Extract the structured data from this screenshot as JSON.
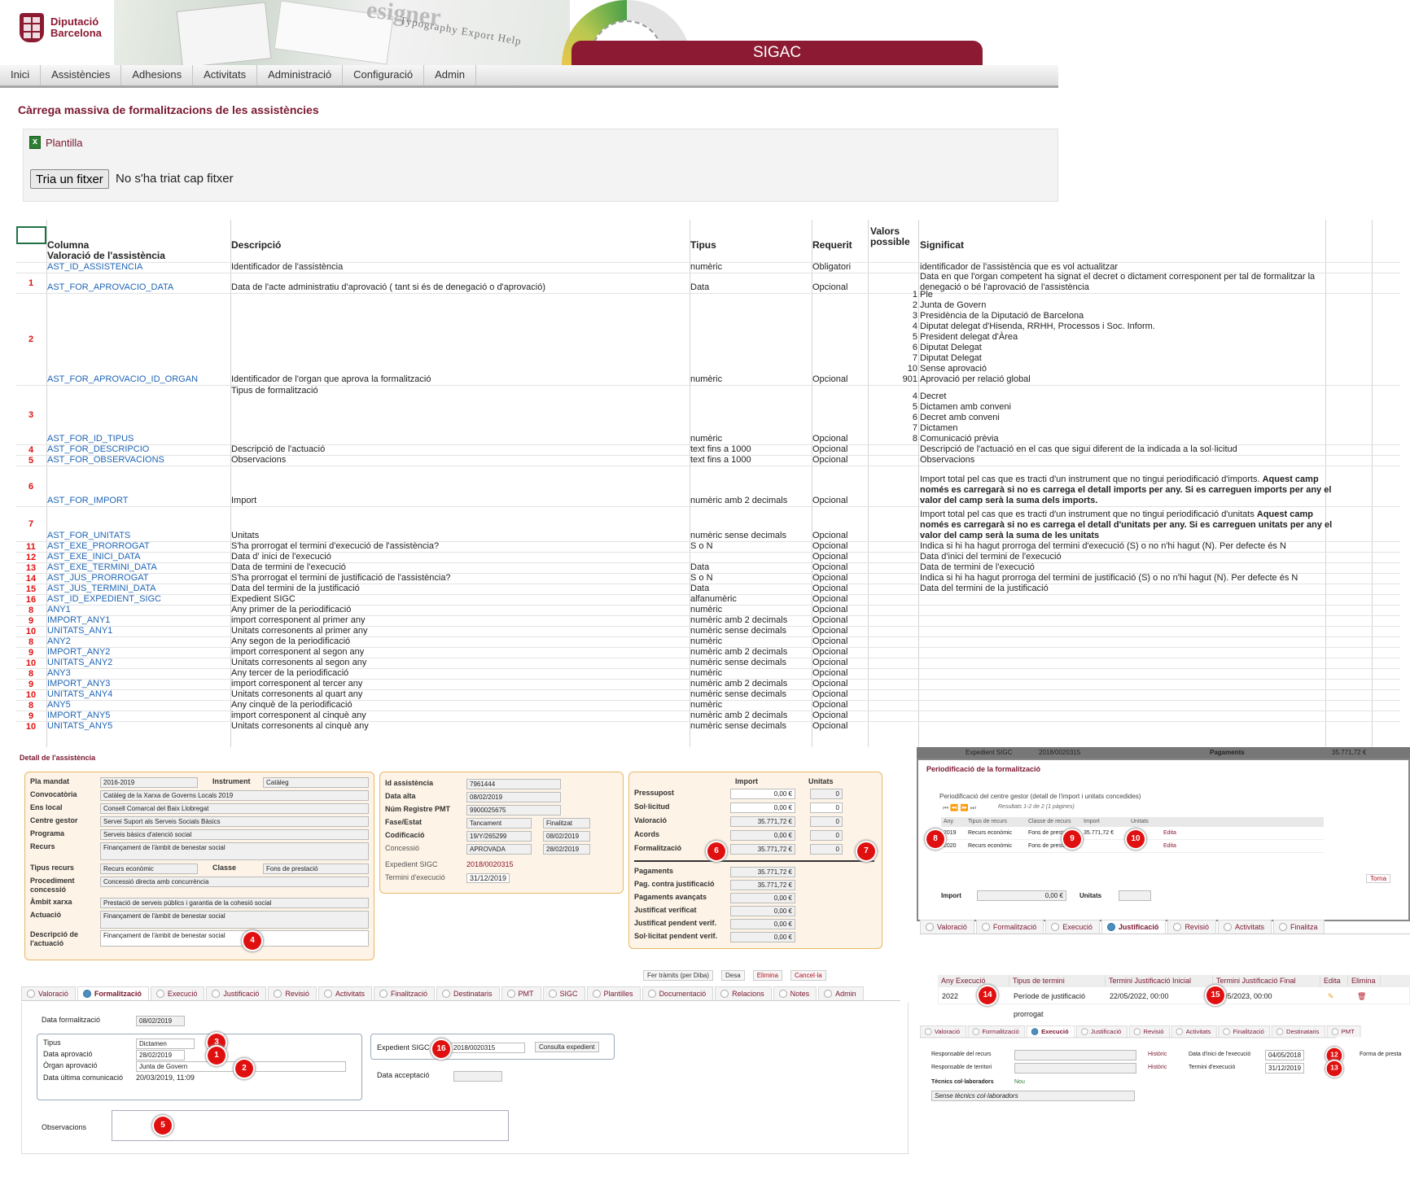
{
  "header": {
    "logo_line1": "Diputació",
    "logo_line2": "Barcelona",
    "banner_text1": "esigner",
    "banner_text2": "Typography  Export  Help",
    "app_name": "SIGAC"
  },
  "nav": [
    "Inici",
    "Assistències",
    "Adhesions",
    "Activitats",
    "Administració",
    "Configuració",
    "Admin"
  ],
  "page": {
    "title": "Càrrega massiva de formalitzacions de les assistències",
    "template_link": "Plantilla",
    "file_button": "Tria un fitxer",
    "file_status": "No s'ha triat cap fitxer"
  },
  "sheet": {
    "headers": {
      "num": "",
      "col": "Columna",
      "desc": "Descripció",
      "tipus": "Tipus",
      "req": "Requerit",
      "vals": "Valors possible",
      "sig": "Significat"
    },
    "section": "Valoració de l'assistència",
    "rows": [
      {
        "n": "",
        "c": "AST_ID_ASSISTENCIA",
        "d": "Identificador de l'assistència",
        "t": "numèric",
        "r": "Obligatori",
        "v": "",
        "s": "identificador de l'assistència que es vol actualitzar"
      },
      {
        "n": "1",
        "c": "AST_FOR_APROVACIO_DATA",
        "d": "Data de l'acte administratiu d'aprovació ( tant si és de denegació o d'aprovació)",
        "t": "Data",
        "r": "Opcional",
        "v": "",
        "s": "Data en que l'organ competent ha signat el decret o dictament corresponent per tal de formalitzar la denegació o bé l'aprovació de l'assistència"
      },
      {
        "n": "2",
        "c": "AST_FOR_APROVACIO_ID_ORGAN",
        "d": "Identificador de l'organ que aprova la formalització",
        "t": "numèric",
        "r": "Opcional",
        "v": "1\n2\n3\n4\n5\n6\n7\n10\n901",
        "s": "Ple\nJunta de Govern\nPresidència de la Diputació de Barcelona\nDiputat delegat d'Hisenda, RRHH, Processos i Soc. Inform.\nPresident delegat d'Àrea\nDiputat Delegat\nDiputat Delegat\nSense aprovació\nAprovació per relació global"
      },
      {
        "n": "3",
        "c": "AST_FOR_ID_TIPUS",
        "d": "Tipus de formalització",
        "t": "numèric",
        "r": "Opcional",
        "v": "4\n5\n6\n7\n8",
        "s": "Decret\nDictamen amb conveni\nDecret amb conveni\nDictamen\nComunicació prèvia"
      },
      {
        "n": "4",
        "c": "AST_FOR_DESCRIPCIO",
        "d": "Descripció de l'actuació",
        "t": "text fins a 1000",
        "r": "Opcional",
        "v": "",
        "s": "Descripció de l'actuació en el cas que sigui diferent de la indicada a la sol·licitud"
      },
      {
        "n": "5",
        "c": "AST_FOR_OBSERVACIONS",
        "d": "Observacions",
        "t": "text fins a 1000",
        "r": "Opcional",
        "v": "",
        "s": "Observacions"
      },
      {
        "n": "6",
        "c": "AST_FOR_IMPORT",
        "d": "Import",
        "t": "numèric amb 2 decimals",
        "r": "Opcional",
        "v": "",
        "s": "Import total pel cas que es tracti d'un instrument que no tingui periodificació d'imports.",
        "sb": "Aquest camp només es carregarà si no es carrega el detall imports per any. Si es carreguen imports per any el valor del camp serà la suma dels imports."
      },
      {
        "n": "7",
        "c": "AST_FOR_UNITATS",
        "d": "Unitats",
        "t": "numèric sense decimals",
        "r": "Opcional",
        "v": "",
        "s": "Import total pel cas que es tracti d'un instrument que no tingui periodificació d'unitats",
        "sb": "Aquest camp només es carregarà si no es carrega el detall d'unitats per any. Si es carreguen unitats per any el valor del camp serà la suma de les unitats"
      },
      {
        "n": "11",
        "c": "AST_EXE_PRORROGAT",
        "d": "S'ha prorrogat el termini d'execució de l'assistència?",
        "t": "S o N",
        "r": "Opcional",
        "v": "",
        "s": "Indica si hi ha hagut prorroga del termini d'execució (S) o no n'hi hagut (N). Per defecte és N"
      },
      {
        "n": "12",
        "c": "AST_EXE_INICI_DATA",
        "d": "Data d' inici de l'execució",
        "t": "",
        "r": "Opcional",
        "v": "",
        "s": "Data d'inici del termini de l'execució"
      },
      {
        "n": "13",
        "c": "AST_EXE_TERMINI_DATA",
        "d": "Data de termini de l'execució",
        "t": "Data",
        "r": "Opcional",
        "v": "",
        "s": "Data de termini de l'execució"
      },
      {
        "n": "14",
        "c": "AST_JUS_PRORROGAT",
        "d": "S'ha prorrogat el termini de justificació de l'assistència?",
        "t": "S o N",
        "r": "Opcional",
        "v": "",
        "s": "Indica si hi ha hagut prorroga del termini de justificació (S) o no n'hi hagut (N). Per defecte és N"
      },
      {
        "n": "15",
        "c": "AST_JUS_TERMINI_DATA",
        "d": "Data del termini de la justificació",
        "t": "Data",
        "r": "Opcional",
        "v": "",
        "s": "Data del termini de la justificació"
      },
      {
        "n": "16",
        "c": "AST_ID_EXPEDIENT_SIGC",
        "d": "Expedient SIGC",
        "t": "alfanumèric",
        "r": "Opcional",
        "v": "",
        "s": ""
      },
      {
        "n": "8",
        "c": "ANY1",
        "d": "Any primer de la periodificació",
        "t": "numèric",
        "r": "Opcional",
        "v": "",
        "s": ""
      },
      {
        "n": "9",
        "c": "IMPORT_ANY1",
        "d": "import corresponent al primer any",
        "t": "numèric amb 2 decimals",
        "r": "Opcional",
        "v": "",
        "s": ""
      },
      {
        "n": "10",
        "c": "UNITATS_ANY1",
        "d": "Unitats corresonents al primer any",
        "t": "numèric sense decimals",
        "r": "Opcional",
        "v": "",
        "s": ""
      },
      {
        "n": "8",
        "c": "ANY2",
        "d": "Any segon de la periodificació",
        "t": "numèric",
        "r": "Opcional",
        "v": "",
        "s": ""
      },
      {
        "n": "9",
        "c": "IMPORT_ANY2",
        "d": "import corresponent al segon any",
        "t": "numèric amb 2 decimals",
        "r": "Opcional",
        "v": "",
        "s": ""
      },
      {
        "n": "10",
        "c": "UNITATS_ANY2",
        "d": "Unitats corresonents al segon any",
        "t": "numèric sense decimals",
        "r": "Opcional",
        "v": "",
        "s": ""
      },
      {
        "n": "8",
        "c": "ANY3",
        "d": "Any tercer de la periodificació",
        "t": "numèric",
        "r": "Opcional",
        "v": "",
        "s": ""
      },
      {
        "n": "9",
        "c": "IMPORT_ANY3",
        "d": "import corresponent al tercer any",
        "t": "numèric amb 2 decimals",
        "r": "Opcional",
        "v": "",
        "s": ""
      },
      {
        "n": "10",
        "c": "UNITATS_ANY4",
        "d": "Unitats corresonents al quart any",
        "t": "numèric sense decimals",
        "r": "Opcional",
        "v": "",
        "s": ""
      },
      {
        "n": "8",
        "c": "ANY5",
        "d": "Any cinquè de la periodificació",
        "t": "numèric",
        "r": "Opcional",
        "v": "",
        "s": ""
      },
      {
        "n": "9",
        "c": "IMPORT_ANY5",
        "d": "import corresponent al cinquè any",
        "t": "numèric amb 2 decimals",
        "r": "Opcional",
        "v": "",
        "s": ""
      },
      {
        "n": "10",
        "c": "UNITATS_ANY5",
        "d": "Unitats corresonents al cinquè any",
        "t": "numèric sense decimals",
        "r": "Opcional",
        "v": "",
        "s": ""
      }
    ]
  },
  "detail": {
    "title": "Detall de l'assistència",
    "left": [
      {
        "l": "Pla mandat",
        "v": "2016-2019",
        "l2": "Instrument",
        "v2": "Catàleg"
      },
      {
        "l": "Convocatòria",
        "v": "Catàleg de la Xarxa de Governs Locals 2019"
      },
      {
        "l": "Ens local",
        "v": "Consell Comarcal del Baix Llobregat"
      },
      {
        "l": "Centre gestor",
        "v": "Servei Suport als Serveis Socials Bàsics"
      },
      {
        "l": "Programa",
        "v": "Serveis bàsics d'atenció social"
      },
      {
        "l": "Recurs",
        "v": "Finançament de l'àmbit de benestar social"
      },
      {
        "l": "Tipus recurs",
        "v": "Recurs econòmic",
        "l2": "Classe",
        "v2": "Fons de prestació"
      },
      {
        "l": "Procediment concessió",
        "v": "Concessió directa amb concurrència"
      },
      {
        "l": "Àmbit xarxa",
        "v": "Prestació de serveis públics i garantia de la cohesió social"
      },
      {
        "l": "Actuació",
        "v": "Finançament de l'àmbit de benestar social"
      },
      {
        "l": "Descripció de l'actuació",
        "v": "Finançament de l'àmbit de benestar social"
      }
    ],
    "mid": [
      {
        "l": "Id assistència",
        "v": "7961444"
      },
      {
        "l": "Data alta",
        "v": "08/02/2019"
      },
      {
        "l": "Núm Registre PMT",
        "v": "9900025675"
      },
      {
        "l": "Fase/Estat",
        "v": "Tancament",
        "v2": "Finalitzat"
      },
      {
        "l": "Codificació",
        "v": "19/Y/265299",
        "v2": "08/02/2019"
      },
      {
        "l": "Concessió",
        "v": "APROVADA",
        "v2": "28/02/2019"
      },
      {
        "l": "Expedient SIGC",
        "v": "2018/0020315"
      },
      {
        "l": "Termini d'execució",
        "v": "31/12/2019"
      }
    ],
    "right_head": {
      "import": "Import",
      "unitats": "Unitats"
    },
    "right": [
      {
        "l": "Pressupost",
        "i": "0,00 €",
        "u": "0"
      },
      {
        "l": "Sol·licitud",
        "i": "0,00 €",
        "u": "0"
      },
      {
        "l": "Valoració",
        "i": "35.771,72 €",
        "u": "0"
      },
      {
        "l": "Acords",
        "i": "0,00 €",
        "u": "0"
      },
      {
        "l": "Formalització",
        "i": "35.771,72 €",
        "u": "0"
      }
    ],
    "right2": [
      {
        "l": "Pagaments",
        "i": "35.771,72 €"
      },
      {
        "l": "Pag. contra justificació",
        "i": "35.771,72 €"
      },
      {
        "l": "Pagaments avançats",
        "i": "0,00 €"
      },
      {
        "l": "Justificat verificat",
        "i": "0,00 €"
      },
      {
        "l": "Justificat pendent verif.",
        "i": "0,00 €"
      },
      {
        "l": "Sol·licitat pendent verif.",
        "i": "0,00 €"
      }
    ],
    "actions": [
      "Fer tràmits (per Diba)",
      "Desa",
      "Elimina",
      "Cancel·la"
    ],
    "tabs": [
      "Valoració",
      "Formalització",
      "Execució",
      "Justificació",
      "Revisió",
      "Activitats",
      "Finalització",
      "Destinataris",
      "PMT",
      "SIGC",
      "Plantilles",
      "Documentació",
      "Relacions",
      "Notes",
      "Admin"
    ],
    "form": {
      "data_form_l": "Data formalització",
      "data_form_v": "08/02/2019",
      "tipus_l": "Tipus",
      "tipus_v": "Dictamen",
      "data_apr_l": "Data aprovació",
      "data_apr_v": "28/02/2019",
      "organ_l": "Òrgan aprovació",
      "organ_v": "Junta de Govern",
      "ult_l": "Data última comunicació",
      "ult_v": "20/03/2019, 11:09",
      "exp_l": "Expedient SIGC",
      "exp_v": "2018/0020315",
      "consulta": "Consulta expedient",
      "accept_l": "Data acceptació",
      "obs_l": "Observacions"
    }
  },
  "period": {
    "top_text1": "Expedient SIGC",
    "top_text2": "2018/0020315",
    "top_text3": "Pagaments",
    "top_text4": "35.771,72 €",
    "title": "Periodificació de la formalització",
    "sub": "Periodificació del centre gestor (detall de l'import i unitats concedides)",
    "results": "Resultats 1-2 de 2 (1 pàgines)",
    "cols": [
      "Any",
      "Tipus de recurs",
      "Classe de recurs",
      "Import",
      "Unitats",
      ""
    ],
    "rows": [
      [
        "2019",
        "Recurs econòmic",
        "Fons de prestació",
        "35.771,72 €",
        "0",
        "Edita"
      ],
      [
        "2020",
        "Recurs econòmic",
        "Fons de prestació",
        "",
        "",
        "Edita"
      ]
    ],
    "torna": "Torna",
    "import_l": "Import",
    "import_v": "0,00 €",
    "unitats_l": "Unitats"
  },
  "just": {
    "tabs": [
      "Valoració",
      "Formalització",
      "Execució",
      "Justificació",
      "Revisió",
      "Activitats",
      "Finalitza"
    ],
    "cols": [
      "Any Execució",
      "Tipus de termini",
      "Termini Justificació Inicial",
      "Termini Justificació Final",
      "Edita",
      "Elimina"
    ],
    "row": [
      "2022",
      "Període de justificació prorrogat",
      "22/05/2022, 00:00",
      "7/05/2023, 00:00"
    ]
  },
  "exec": {
    "tabs": [
      "Valoració",
      "Formalització",
      "Execució",
      "Justificació",
      "Revisió",
      "Activitats",
      "Finalització",
      "Destinataris",
      "PMT"
    ],
    "resp_l": "Responsable del recurs",
    "resp_t": "Responsable de territori",
    "hist": "Històric",
    "ini_l": "Data d'inici de l'execució",
    "ini_v": "04/05/2018",
    "term_l": "Termini d'execució",
    "term_v": "31/12/2019",
    "forma": "Forma de presta",
    "tec_l": "Tècnics col·laboradors",
    "tec_new": "Nou",
    "tec_none": "Sense tècnics col·laboradors"
  }
}
